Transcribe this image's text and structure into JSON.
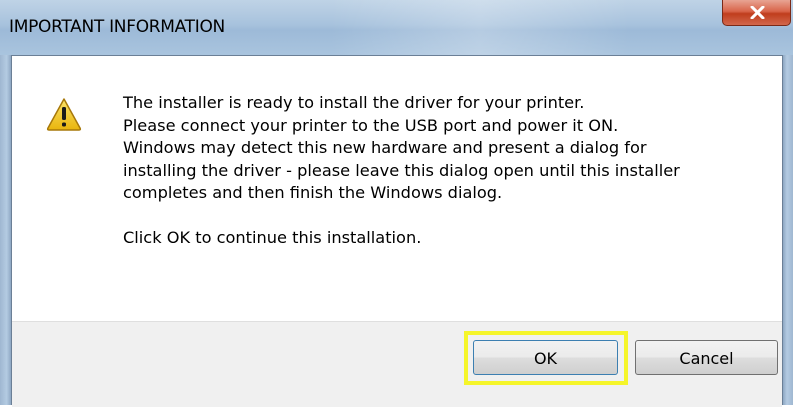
{
  "window": {
    "title": "IMPORTANT INFORMATION",
    "close_symbol": "X"
  },
  "dialog": {
    "icon": "warning-triangle-icon",
    "lines": [
      "The installer is ready to install the driver for your printer.",
      "Please connect your printer to the USB port and power it ON.",
      "Windows may detect this new hardware and present a dialog for",
      "installing the driver - please leave this dialog open until this installer",
      "completes and then finish the Windows dialog."
    ],
    "footer_line": "Click OK to continue this installation."
  },
  "buttons": {
    "ok_label": "OK",
    "cancel_label": "Cancel"
  },
  "colors": {
    "titlebar": "#a7c2dd",
    "close_button": "#c03d1d",
    "highlight": "#f5f52a",
    "warning_fill": "#f2c811"
  }
}
